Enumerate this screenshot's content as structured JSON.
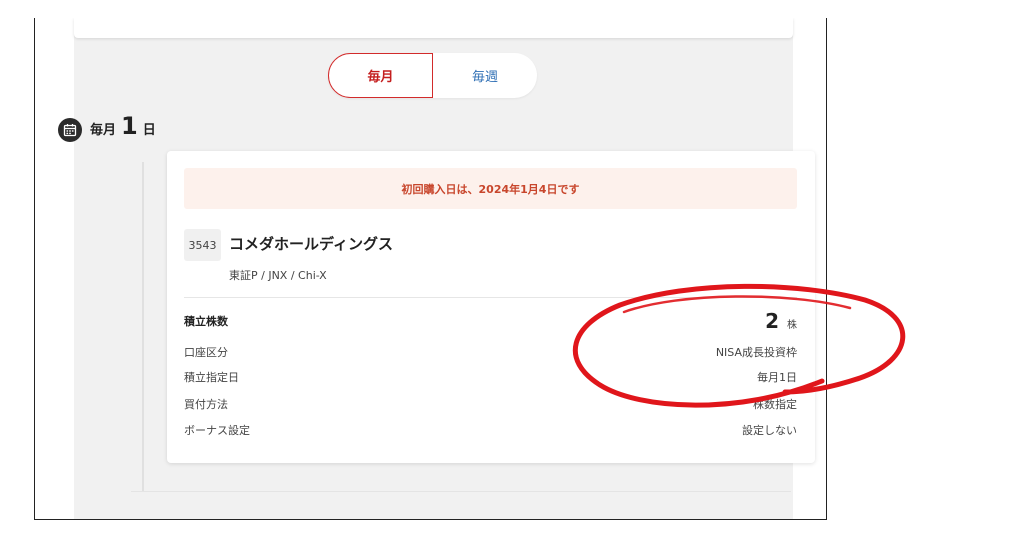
{
  "frequency_toggle": {
    "options": [
      {
        "label": "毎月",
        "active": true
      },
      {
        "label": "毎週",
        "active": false
      }
    ]
  },
  "schedule": {
    "prefix": "毎月",
    "day": "1",
    "suffix": "日"
  },
  "order_card": {
    "notice": "初回購入日は、2024年1月4日です",
    "stock": {
      "code": "3543",
      "name": "コメダホールディングス",
      "market": "東証P / JNX / Chi-X"
    },
    "details": [
      {
        "label": "積立株数",
        "value": "2",
        "unit": "株"
      },
      {
        "label": "口座区分",
        "value": "NISA成長投資枠"
      },
      {
        "label": "積立指定日",
        "value": "毎月1日"
      },
      {
        "label": "買付方法",
        "value": "株数指定"
      },
      {
        "label": "ボーナス設定",
        "value": "設定しない"
      }
    ]
  },
  "colors": {
    "accent_red": "#c41e1e",
    "link_blue": "#2f6fb5",
    "notice_bg": "#fdf1ec",
    "notice_text": "#c8462c",
    "highlight_red": "#e0161b"
  }
}
